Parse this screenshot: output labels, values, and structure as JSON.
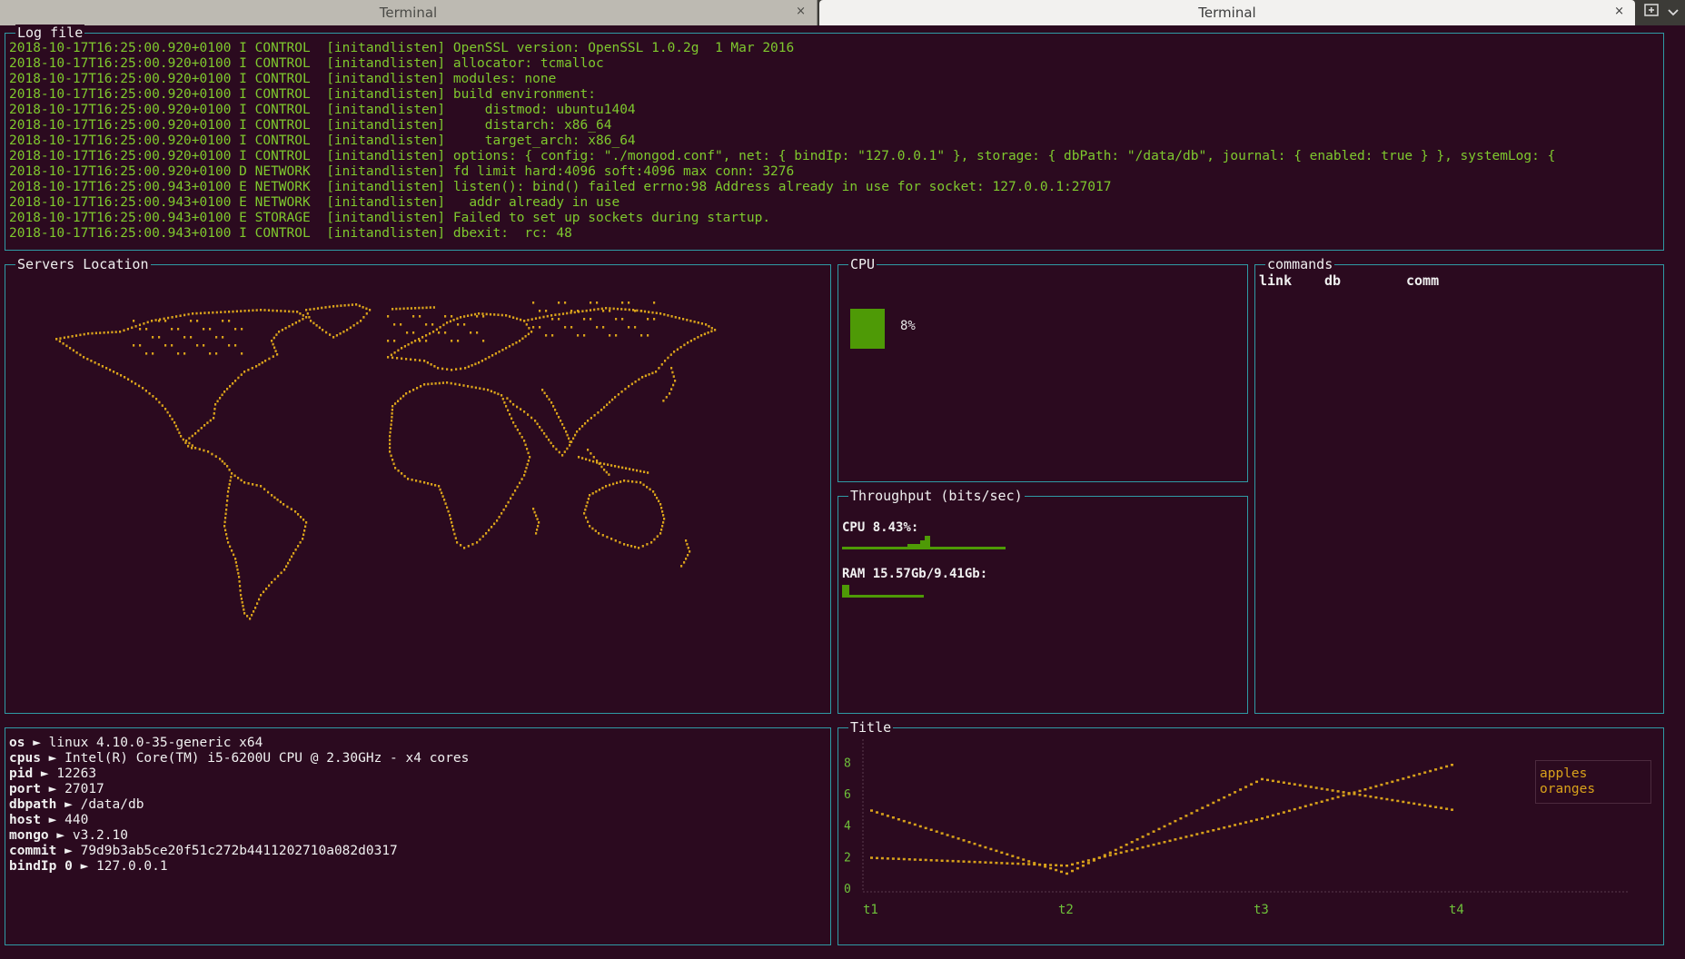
{
  "tabs": [
    {
      "label": "Terminal",
      "active": false
    },
    {
      "label": "Terminal",
      "active": true
    }
  ],
  "tab_close_glyph": "×",
  "tab_bar_icons": {
    "new_tab": "new-tab-icon",
    "menu": "chevron-down-icon"
  },
  "panels": {
    "log": {
      "title": "Log file"
    },
    "map": {
      "title": "Servers Location"
    },
    "cpu": {
      "title": "CPU"
    },
    "throughput": {
      "title": "Throughput (bits/sec)"
    },
    "commands": {
      "title": "commands"
    },
    "chart": {
      "title": "Title"
    }
  },
  "log_lines": [
    "2018-10-17T16:25:00.920+0100 I CONTROL  [initandlisten] OpenSSL version: OpenSSL 1.0.2g  1 Mar 2016",
    "2018-10-17T16:25:00.920+0100 I CONTROL  [initandlisten] allocator: tcmalloc",
    "2018-10-17T16:25:00.920+0100 I CONTROL  [initandlisten] modules: none",
    "2018-10-17T16:25:00.920+0100 I CONTROL  [initandlisten] build environment:",
    "2018-10-17T16:25:00.920+0100 I CONTROL  [initandlisten]     distmod: ubuntu1404",
    "2018-10-17T16:25:00.920+0100 I CONTROL  [initandlisten]     distarch: x86_64",
    "2018-10-17T16:25:00.920+0100 I CONTROL  [initandlisten]     target_arch: x86_64",
    "2018-10-17T16:25:00.920+0100 I CONTROL  [initandlisten] options: { config: \"./mongod.conf\", net: { bindIp: \"127.0.0.1\" }, storage: { dbPath: \"/data/db\", journal: { enabled: true } }, systemLog: {",
    "2018-10-17T16:25:00.920+0100 D NETWORK  [initandlisten] fd limit hard:4096 soft:4096 max conn: 3276",
    "2018-10-17T16:25:00.943+0100 E NETWORK  [initandlisten] listen(): bind() failed errno:98 Address already in use for socket: 127.0.0.1:27017",
    "2018-10-17T16:25:00.943+0100 E NETWORK  [initandlisten]   addr already in use",
    "2018-10-17T16:25:00.943+0100 E STORAGE  [initandlisten] Failed to set up sockets during startup.",
    "2018-10-17T16:25:00.943+0100 I CONTROL  [initandlisten] dbexit:  rc: 48"
  ],
  "cpu": {
    "value": "8%",
    "fill_fraction": 0.85,
    "color": "#4e9a06"
  },
  "throughput": {
    "cpu_label": "CPU 8.43%:",
    "ram_label": "RAM 15.57Gb/9.41Gb:",
    "sparkline_color": "#4e9a06"
  },
  "commands": {
    "headers": [
      "link",
      "db",
      "comm"
    ]
  },
  "info": [
    {
      "key": "os",
      "value": "linux 4.10.0-35-generic x64"
    },
    {
      "key": "cpus",
      "value": "Intel(R) Core(TM) i5-6200U CPU @ 2.30GHz - x4 cores"
    },
    {
      "key": "pid",
      "value": "12263"
    },
    {
      "key": "port",
      "value": "27017"
    },
    {
      "key": "dbpath",
      "value": "/data/db"
    },
    {
      "key": "host",
      "value": "440"
    },
    {
      "key": "mongo",
      "value": "v3.2.10"
    },
    {
      "key": "commit",
      "value": "79d9b3ab5ce20f51c272b4411202710a082d0317"
    },
    {
      "key": "bindIp 0",
      "value": "127.0.0.1"
    }
  ],
  "info_arrow": "►",
  "colors": {
    "background": "#2b0a1f",
    "border": "#2f9aa5",
    "log_text": "#7fc92e",
    "map_dots": "#d9a21b",
    "chart_series": "#d9a21b",
    "chart_axis_labels": "#6fc23a",
    "legend_text": "#d9a21b"
  },
  "chart_data": {
    "type": "line",
    "title": "Title",
    "categories": [
      "t1",
      "t2",
      "t3",
      "t4"
    ],
    "yticks": [
      0,
      2,
      4,
      6,
      8
    ],
    "ylim": [
      0,
      9
    ],
    "legend_position": "right",
    "series": [
      {
        "name": "apples",
        "values": [
          5,
          1,
          7,
          5
        ]
      },
      {
        "name": "oranges",
        "values": [
          2,
          1.5,
          4.5,
          8
        ]
      }
    ]
  }
}
